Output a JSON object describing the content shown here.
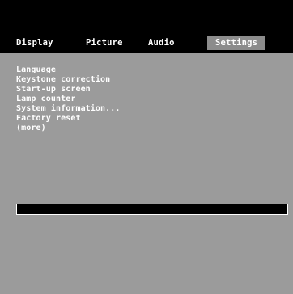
{
  "menu": {
    "tabs": [
      {
        "label": "Display"
      },
      {
        "label": "Picture"
      },
      {
        "label": "Audio"
      },
      {
        "label": "Settings",
        "active": true
      }
    ]
  },
  "settings": {
    "items": [
      {
        "label": "Language"
      },
      {
        "label": "Keystone correction"
      },
      {
        "label": "Start-up screen"
      },
      {
        "label": "Lamp counter"
      },
      {
        "label": "System information..."
      },
      {
        "label": "Factory reset"
      },
      {
        "label": "(more)"
      }
    ]
  },
  "colors": {
    "background": "#000000",
    "panel": "#9b9b9b",
    "active_tab": "#8c8c8c",
    "text": "#ffffff"
  }
}
